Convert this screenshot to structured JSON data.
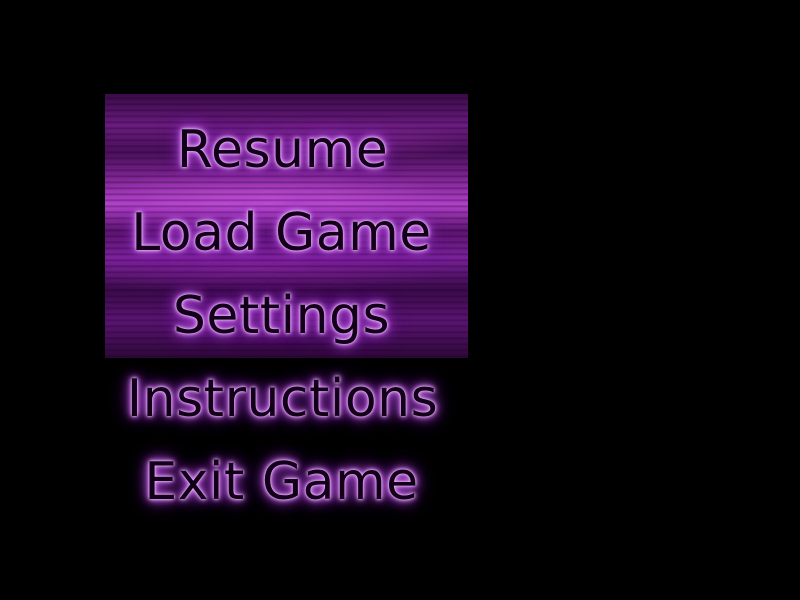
{
  "menu": {
    "items": [
      {
        "label": "Resume"
      },
      {
        "label": "Load Game"
      },
      {
        "label": "Settings"
      },
      {
        "label": "Instructions"
      },
      {
        "label": "Exit Game"
      }
    ]
  },
  "colors": {
    "background": "#000000",
    "text": "#120018",
    "glow": "#d37df0",
    "panel": "#8a2aa0"
  }
}
